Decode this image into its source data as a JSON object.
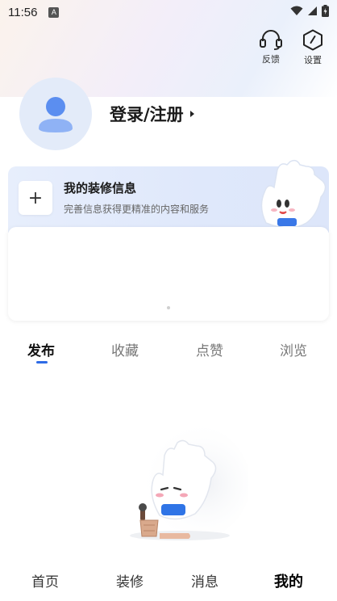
{
  "status_bar": {
    "time": "11:56",
    "notification_icon": "A"
  },
  "top_actions": [
    {
      "icon": "headset-icon",
      "label": "反馈"
    },
    {
      "icon": "settings-hexagon-icon",
      "label": "设置"
    }
  ],
  "profile": {
    "login_label": "登录/注册"
  },
  "renovation_card": {
    "title": "我的装修信息",
    "subtitle": "完善信息获得更精准的内容和服务",
    "add_icon": "+"
  },
  "tabs": [
    {
      "label": "发布",
      "active": true
    },
    {
      "label": "收藏",
      "active": false
    },
    {
      "label": "点赞",
      "active": false
    },
    {
      "label": "浏览",
      "active": false
    }
  ],
  "bottom_nav": [
    {
      "label": "首页",
      "active": false
    },
    {
      "label": "装修",
      "active": false
    },
    {
      "label": "消息",
      "active": false
    },
    {
      "label": "我的",
      "active": true
    }
  ],
  "colors": {
    "accent": "#2e6be6",
    "card_bg": "#e3ebfb"
  }
}
